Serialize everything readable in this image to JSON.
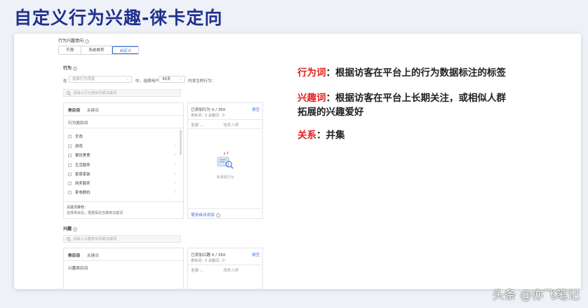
{
  "slide": {
    "title": "自定义行为兴趣-徕卡定向",
    "watermark": "头条 @亦飞笔记"
  },
  "form": {
    "section_label": "行为兴趣意向",
    "segments": [
      {
        "label": "不限",
        "active": false
      },
      {
        "label": "系统推荐",
        "active": false
      },
      {
        "label": "自定义",
        "active": true
      }
    ],
    "behavior": {
      "heading": "行为",
      "prefix": "在",
      "scene_placeholder": "选择行为场景",
      "mid_text": "中，选择用户",
      "days_value": "30天",
      "suffix": "内发生的行为：",
      "search_placeholder": "请输入行为类目词或关键词",
      "tabs": [
        "类目词",
        "关键词"
      ],
      "list_header": "行为类目词",
      "categories": [
        "全选",
        "游戏",
        "餐饮美食",
        "生活服务",
        "家居家装",
        "商务服务",
        "家电数码"
      ],
      "recommend_title": "关键词推荐：",
      "recommend_desc": "选择类目后，根据相关性推荐关键词",
      "selected": {
        "title": "已添加行为 0 / 350",
        "clear_label": "清空",
        "counts": "类目词：0    关键词：0",
        "filter_label": "全部",
        "search_placeholder": "搜索人群",
        "empty_label": "未添加行为",
        "auto_link": "使用自动添加"
      }
    },
    "interest": {
      "heading": "兴趣",
      "search_placeholder": "请输入兴趣类目词或关键词",
      "tabs": [
        "类目词",
        "关键词"
      ],
      "list_header": "兴趣类目词",
      "selected": {
        "title": "已添加兴趣 0 / 350",
        "clear_label": "清空",
        "counts": "类目词：0    关键词：0",
        "filter_label": "全部",
        "search_placeholder": "搜索人群"
      }
    }
  },
  "explanation": {
    "behavior_term": "行为词",
    "behavior_def": "：根据访客在平台上的行为数据标注的标签",
    "interest_term": "兴趣词",
    "interest_def_1": "：根据访客在平台上长期关注，或相似人群",
    "interest_def_2": "拓展的兴趣爱好",
    "relation_term": "关系",
    "relation_def": "：并集"
  },
  "colors": {
    "title": "#21308f",
    "accent": "#3b6fd8",
    "term_red": "#e02020"
  }
}
